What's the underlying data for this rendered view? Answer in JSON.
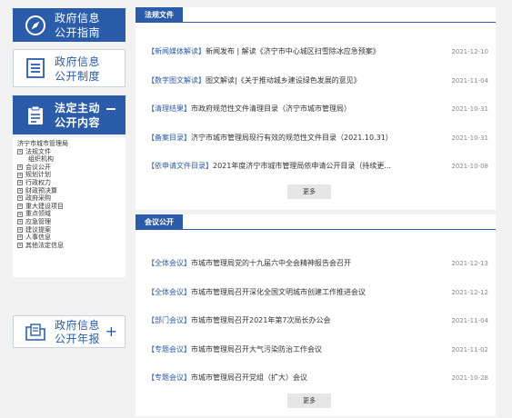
{
  "sidebar": {
    "guide": {
      "line1": "政府信息",
      "line2": "公开指南",
      "icon": "compass-icon"
    },
    "system": {
      "line1": "政府信息",
      "line2": "公开制度",
      "icon": "document-list-icon"
    },
    "content": {
      "line1": "法定主动",
      "line2": "公开内容",
      "icon": "clipboard-icon"
    },
    "tree": {
      "root": "济宁市城市管理局",
      "items": [
        {
          "label": "法规文件",
          "expandable": true
        },
        {
          "label": "组织机构",
          "expandable": false
        },
        {
          "label": "会议公开",
          "expandable": true
        },
        {
          "label": "规划计划",
          "expandable": true
        },
        {
          "label": "行政权力",
          "expandable": true
        },
        {
          "label": "财政预决算",
          "expandable": true
        },
        {
          "label": "政府采购",
          "expandable": true
        },
        {
          "label": "重大建设项目",
          "expandable": true
        },
        {
          "label": "重点领域",
          "expandable": true
        },
        {
          "label": "应急管理",
          "expandable": true
        },
        {
          "label": "建议提案",
          "expandable": true
        },
        {
          "label": "人事信息",
          "expandable": true
        },
        {
          "label": "其他法定信息",
          "expandable": true
        }
      ]
    },
    "annual": {
      "line1": "政府信息",
      "line2": "公开年报",
      "icon": "folder-document-icon"
    }
  },
  "files": {
    "tab": "法规文件",
    "more": "更多",
    "rows": [
      {
        "tag": "【新闻媒体解读】",
        "title": "新闻发布 | 解读《济宁市中心城区扫雪除冰应急预案》",
        "date": "2021-12-10"
      },
      {
        "tag": "【数字图文解读】",
        "title": "图文解读|《关于推动城乡建设绿色发展的意见》",
        "date": "2021-11-04"
      },
      {
        "tag": "【清理结果】",
        "title": "市政府规范性文件清理目录（济宁市城市管理局）",
        "date": "2021-10-31"
      },
      {
        "tag": "【备案目录】",
        "title": "济宁市城市管理局现行有效的规范性文件目录（2021.10.31）",
        "date": "2021-10-31"
      },
      {
        "tag": "【依申请文件目录】",
        "title": "2021年度济宁市城市管理局依申请公开目录（持续更...",
        "date": "2021-10-08"
      }
    ]
  },
  "meetings": {
    "tab": "会议公开",
    "more": "更多",
    "rows": [
      {
        "tag": "【全体会议】",
        "title": "市城市管理局党的十九届六中全会精神报告会召开",
        "date": "2021-12-13"
      },
      {
        "tag": "【全体会议】",
        "title": "市城市管理局召开深化全国文明城市创建工作推进会议",
        "date": "2021-12-12"
      },
      {
        "tag": "【部门会议】",
        "title": "市城市管理局召开2021年第7次局长办公会",
        "date": "2021-11-04"
      },
      {
        "tag": "【专题会议】",
        "title": "市城市管理局召开大气污染防治工作会议",
        "date": "2021-11-02"
      },
      {
        "tag": "【专题会议】",
        "title": "市城市管理局召开党组（扩大）会议",
        "date": "2021-10-28"
      }
    ]
  },
  "colors": {
    "accent": "#2a5caa",
    "date": "#888888",
    "background": "#f2f2f2"
  }
}
